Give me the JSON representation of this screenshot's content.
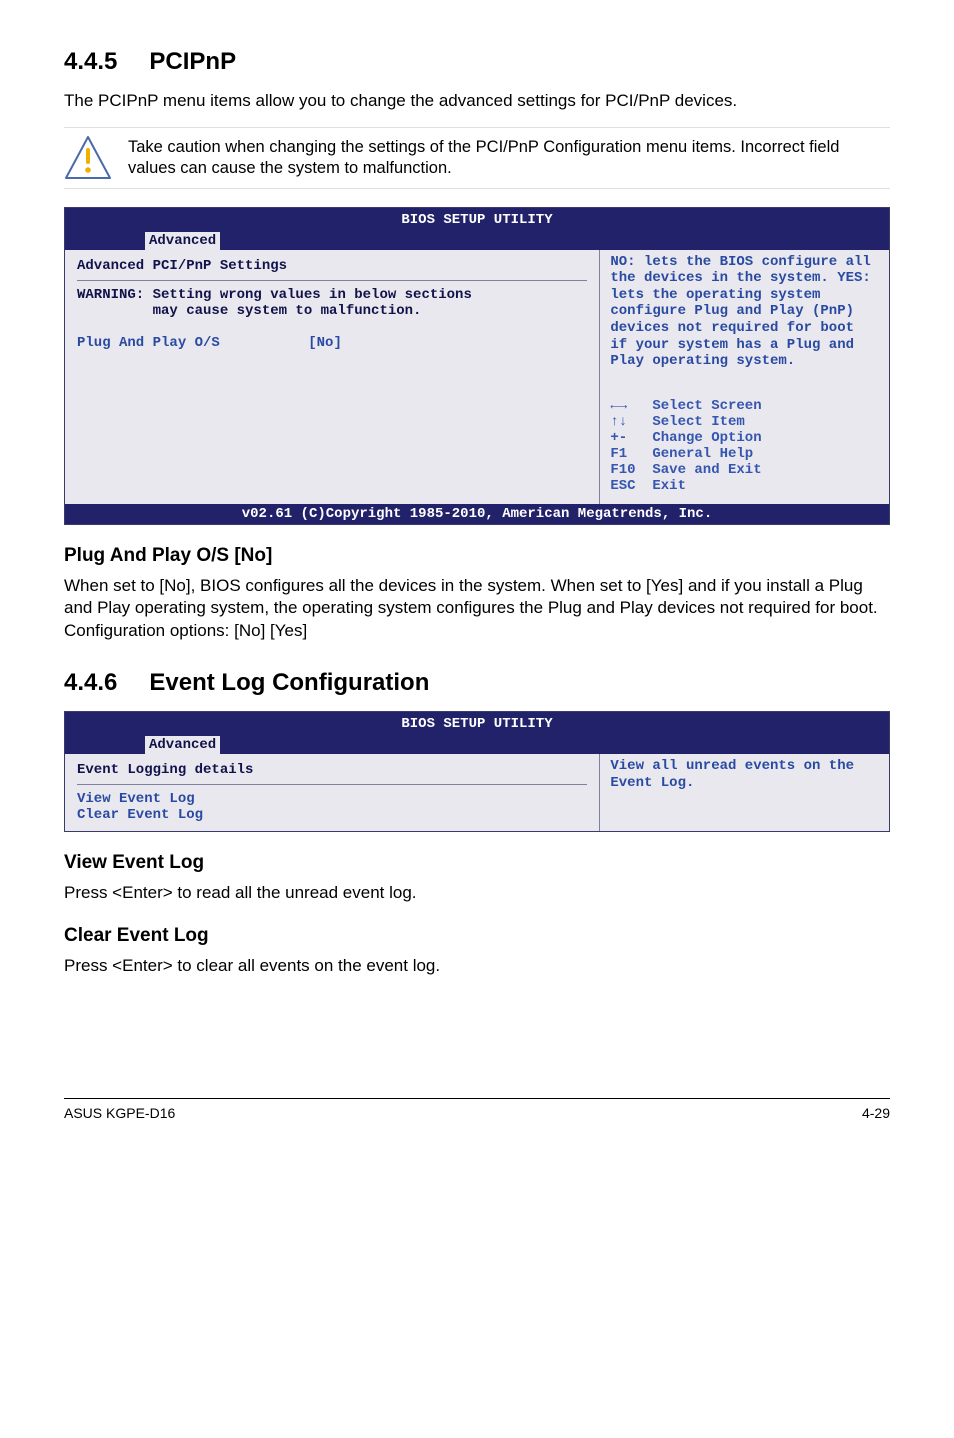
{
  "section1": {
    "number": "4.4.5",
    "title": "PCIPnP",
    "intro": "The PCIPnP menu items allow you to change the advanced settings for PCI/PnP devices.",
    "caution": "Take caution when changing the settings of the PCI/PnP Configuration menu items. Incorrect field values can cause the system to malfunction."
  },
  "bios1": {
    "title": "BIOS SETUP UTILITY",
    "active_tab": "Advanced",
    "left": {
      "heading": "Advanced PCI/PnP Settings",
      "warning_l1": "WARNING: Setting wrong values in below sections",
      "warning_l2": "         may cause system to malfunction.",
      "field_label": "Plug And Play O/S",
      "field_value": "[No]"
    },
    "right_hint": "NO: lets the BIOS configure all the devices in the system. YES: lets the operating system configure Plug and Play (PnP) devices not required for boot if your system has a Plug and Play operating system.",
    "keys": {
      "k1": "←→   Select Screen",
      "k2": "↑↓   Select Item",
      "k3": "+-   Change Option",
      "k4": "F1   General Help",
      "k5": "F10  Save and Exit",
      "k6": "ESC  Exit"
    },
    "footer": "v02.61 (C)Copyright 1985-2010, American Megatrends, Inc."
  },
  "plugplay": {
    "heading": "Plug And Play O/S [No]",
    "para": "When set to [No], BIOS configures all the devices in the system. When set to [Yes] and if you install a Plug and Play operating system, the operating system configures the Plug and Play devices not required for boot.",
    "opts": "Configuration options: [No] [Yes]"
  },
  "section2": {
    "number": "4.4.6",
    "title": "Event Log Configuration"
  },
  "bios2": {
    "title": "BIOS SETUP UTILITY",
    "active_tab": "Advanced",
    "left": {
      "heading": "Event Logging details",
      "link1": "View Event Log",
      "link2": "Clear Event Log"
    },
    "right_hint": "View all unread events on the Event Log."
  },
  "viewlog": {
    "heading": "View Event Log",
    "para": "Press <Enter> to read all the unread event log."
  },
  "clearlog": {
    "heading": "Clear Event Log",
    "para": "Press <Enter> to clear all events on the event log."
  },
  "footer": {
    "left": "ASUS KGPE-D16",
    "right": "4-29"
  }
}
